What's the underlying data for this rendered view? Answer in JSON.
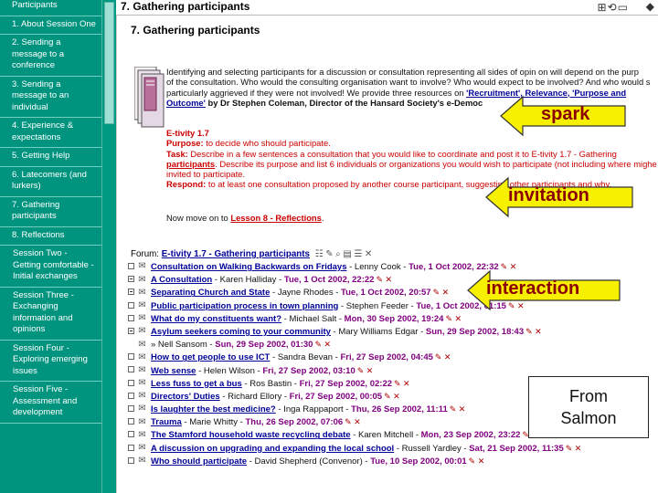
{
  "sidebar": {
    "items": [
      {
        "label": "Participants"
      },
      {
        "label": "1. About Session One"
      },
      {
        "label": "2. Sending a message to a conference"
      },
      {
        "label": "3. Sending a message to an individual"
      },
      {
        "label": "4. Experience & expectations"
      },
      {
        "label": "5. Getting Help"
      },
      {
        "label": "6. Latecomers (and lurkers)"
      },
      {
        "label": "7. Gathering participants"
      },
      {
        "label": "8. Reflections"
      },
      {
        "label": "Session Two - Getting comfortable - Initial exchanges"
      },
      {
        "label": "Session Three - Exchanging information and opinions"
      },
      {
        "label": "Session Four - Exploring emerging issues"
      },
      {
        "label": "Session Five - Assessment and development"
      }
    ]
  },
  "topbar": {
    "title": "7. Gathering participants",
    "icons": "⊞⟲▭",
    "corner": "◆"
  },
  "page": {
    "title": "7. Gathering participants",
    "intro": {
      "line1": "Identifying and selecting participants for a discussion or consultation representing all sides of opin on will depend on the purp",
      "line2": "of the consultation. Who would the consulting organisation want to involve? Who would expect to be involved? And who would s",
      "line3": "particularly aggrieved if they were not involved! We provide three resources on",
      "link1": "'Recruitment', Relevance, 'Purpose and",
      "link2": "Outcome'",
      "byline": "by Dr Stephen Coleman, Director of the Hansard Society's e-Democ"
    },
    "etivity": {
      "heading": "E-tivity 1.7",
      "purpose_label": "Purpose:",
      "purpose": "to decide who should participate.",
      "task_label": "Task:",
      "task1": "Describe in a few sentences a consultation that you would like to coordinate and post it to E-tivity 1.7 - Gathering",
      "task_link": "participants",
      "task2": ". Describe its purpose and list 6 individuals or organizations you would wish to participate (not including where mighe gh",
      "task3": "invited to participate.",
      "respond_label": "Respond:",
      "respond": "to at least one consultation proposed by another course participant, suggesting other participants and why."
    },
    "move_on": {
      "text": "Now move on to",
      "link": "Lesson 8 - Reflections",
      "end": "."
    }
  },
  "forum": {
    "label": "Forum:",
    "name": "E-tivity 1.7 - Gathering participants",
    "tools": "☷ ✎ ⌕ ▤ ☰ ✕",
    "threads": [
      {
        "square": "",
        "title": "Consultation on Walking Backwards on Fridays",
        "author": " - Lenny Cook - ",
        "date": "Tue, 1 Oct 2002, 22:32",
        "tail": "✎ ✕"
      },
      {
        "square": "open",
        "title": "A Consultation",
        "author": " - Karen Halliday - ",
        "date": "Tue, 1 Oct 2002, 22:22",
        "tail": "✎ ✕"
      },
      {
        "square": "open",
        "title": "Separating Church and State",
        "author": " - Jayne Rhodes - ",
        "date": "Tue, 1 Oct 2002, 20:57",
        "tail": "✎ ✕"
      },
      {
        "square": "",
        "title": "Public participation process in town planning",
        "author": " - Stephen Feeder - ",
        "date": "Tue, 1 Oct 2002, 01:15",
        "tail": "✎ ✕"
      },
      {
        "square": "",
        "title": "What do my constituents want?",
        "author": " - Michael Salt - ",
        "date": "Mon, 30 Sep 2002, 19:24",
        "tail": "✎ ✕"
      },
      {
        "square": "open",
        "title": "Asylum seekers coming to your community",
        "author": " - Mary Williams Edgar - ",
        "date": "Sun, 29 Sep 2002, 18:43",
        "tail": "✎ ✕"
      },
      {
        "square": "hide",
        "title": "",
        "author": "» Nell Sansom - ",
        "date": "Sun, 29 Sep 2002, 01:30",
        "tail": "✎ ✕"
      },
      {
        "square": "",
        "title": "How to get people to use ICT",
        "author": " - Sandra Bevan - ",
        "date": "Fri, 27 Sep 2002, 04:45",
        "tail": "✎ ✕"
      },
      {
        "square": "",
        "title": "Web sense",
        "author": " - Helen Wilson - ",
        "date": "Fri, 27 Sep 2002, 03:10",
        "tail": "✎ ✕"
      },
      {
        "square": "",
        "title": "Less fuss to get a bus",
        "author": " - Ros Bastin - ",
        "date": "Fri, 27 Sep 2002, 02:22",
        "tail": "✎ ✕"
      },
      {
        "square": "",
        "title": "Directors' Duties",
        "author": " - Richard Ellory - ",
        "date": "Fri, 27 Sep 2002, 00:05",
        "tail": "✎ ✕"
      },
      {
        "square": "",
        "title": "Is laughter the best medicine?",
        "author": " - Inga Rappaport - ",
        "date": "Thu, 26 Sep 2002, 11:11",
        "tail": "✎ ✕"
      },
      {
        "square": "",
        "title": "Trauma",
        "author": " - Marie Whitty - ",
        "date": "Thu, 26 Sep 2002, 07:06",
        "tail": "✎ ✕"
      },
      {
        "square": "",
        "title": "The Stamford household waste recycling debate",
        "author": " - Karen Mitchell - ",
        "date": "Mon, 23 Sep 2002, 23:22",
        "tail": "✎ ✕"
      },
      {
        "square": "",
        "title": "A discussion on upgrading and expanding the local school",
        "author": " - Russell Yardley - ",
        "date": "Sat, 21 Sep 2002, 11:35",
        "tail": "✎ ✕"
      },
      {
        "square": "",
        "title": "Who should participate",
        "author": " - David Shepherd (Convenor) - ",
        "date": "Tue, 10 Sep 2002, 00:01",
        "tail": "✎ ✕"
      }
    ]
  },
  "callouts": {
    "spark": "spark",
    "invitation": "invitation",
    "interaction": "interaction",
    "from_line1": "From",
    "from_line2": "Salmon",
    "arrow_fill": "#f7f000",
    "text_color": "#8b0000"
  },
  "colors": {
    "sidebar_bg": "#00947f",
    "link": "#000099",
    "etivity_red": "#cc0000",
    "date_purple": "#800080"
  }
}
